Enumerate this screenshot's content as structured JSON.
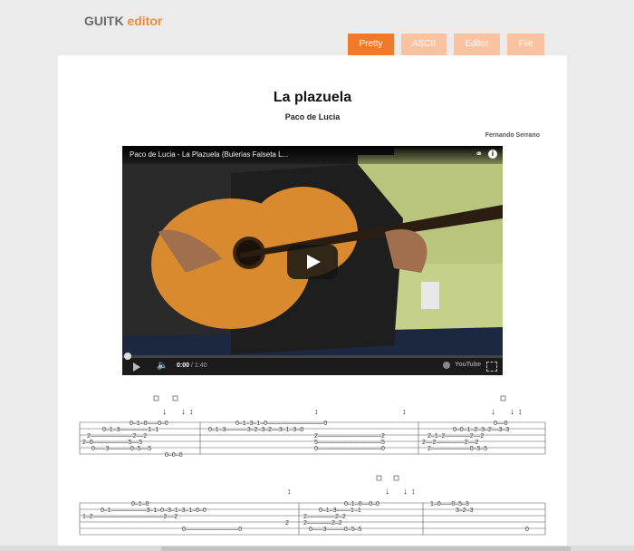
{
  "app": {
    "title_part1": "GUITK",
    "title_part2": "editor"
  },
  "tabs": [
    {
      "label": "Pretty",
      "active": true
    },
    {
      "label": "ASCII",
      "active": false
    },
    {
      "label": "Editor",
      "active": false
    },
    {
      "label": "File",
      "active": false
    }
  ],
  "song": {
    "title": "La plazuela",
    "artist": "Paco de Lucia",
    "author": "Fernando Serrano"
  },
  "video": {
    "title": "Paco de Lucia - La Plazuela (Bulerias Falseta L...",
    "current_time": "0:00",
    "duration": "/ 1:40",
    "brand": "YouTube",
    "progress": 0
  },
  "icons": {
    "share": "share-icon",
    "info": "info-icon",
    "play": "play-icon",
    "volume": "volume-icon",
    "fullscreen": "fullscreen-icon"
  },
  "colors": {
    "accent": "#f07a2a",
    "accent_light": "#f9c2a0",
    "logo_gray": "#6b6b6b"
  }
}
